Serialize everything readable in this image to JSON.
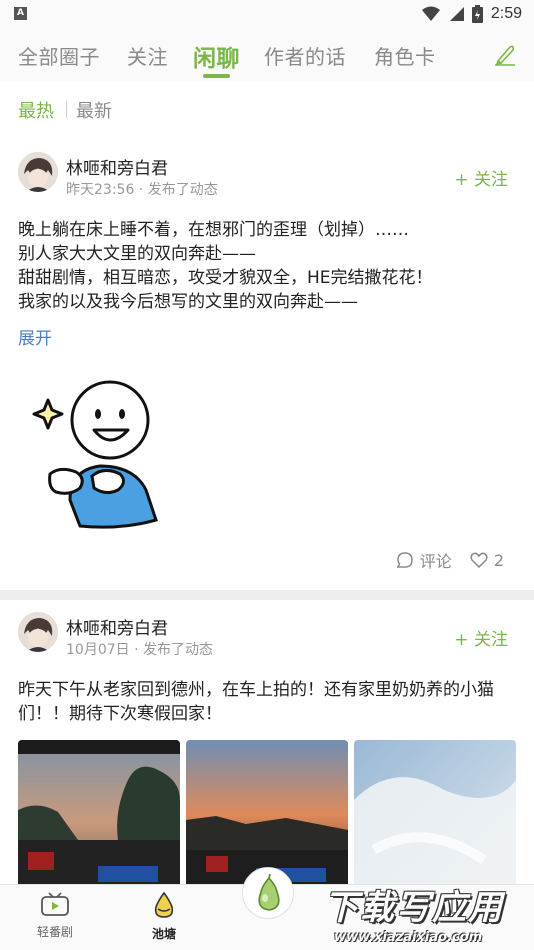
{
  "status_bar": {
    "time": "2:59",
    "left_icon": "A"
  },
  "top_nav": {
    "tabs": [
      {
        "label": "全部圈子",
        "active": false
      },
      {
        "label": "关注",
        "active": false
      },
      {
        "label": "闲聊",
        "active": true
      },
      {
        "label": "作者的话",
        "active": false
      },
      {
        "label": "角色卡",
        "active": false
      }
    ],
    "right_icon": "write-pen-icon"
  },
  "sub_nav": {
    "hot": "最热",
    "new": "最新"
  },
  "posts": [
    {
      "author": "林咂和旁白君",
      "meta": "昨天23:56 · 发布了动态",
      "follow": "+ 关注",
      "text": [
        "晚上躺在床上睡不着，在想邪门的歪理（划掉）……",
        "别人家大大文里的双向奔赴——",
        "甜甜剧情，相互暗恋，攻受才貌双全，HE完结撒花花！",
        "我家的以及我今后想写的文里的双向奔赴——"
      ],
      "expand": "展开",
      "comment_label": "评论",
      "like_count": "2"
    },
    {
      "author": "林咂和旁白君",
      "meta": "10月07日 · 发布了动态",
      "follow": "+ 关注",
      "text": [
        "昨天下午从老家回到德州，在车上拍的！还有家里奶奶养的小猫",
        "们！！期待下次寒假回家！"
      ]
    }
  ],
  "bottom_bar": {
    "items": [
      {
        "label": "轻番剧",
        "icon": "tv-icon"
      },
      {
        "label": "池塘",
        "icon": "pond-icon",
        "active": true
      }
    ],
    "center_icon": "pear-icon"
  },
  "watermark": {
    "title": "下载写应用",
    "url": "www.xiazaixiao.com"
  },
  "colors": {
    "accent": "#7ab648",
    "link": "#4a7fbf",
    "muted": "#8a8a8a"
  }
}
